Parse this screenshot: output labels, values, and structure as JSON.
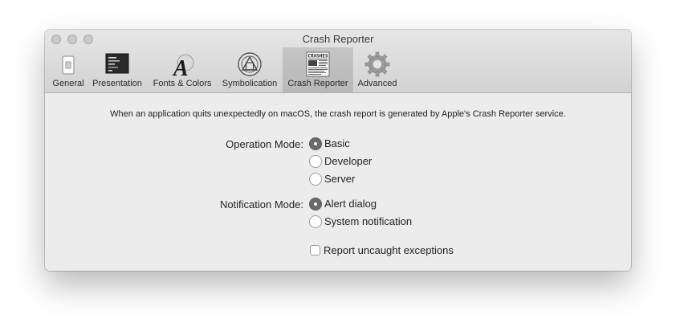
{
  "window": {
    "title": "Crash Reporter"
  },
  "tabs": [
    {
      "label": "General",
      "icon": "switch-icon",
      "selected": false
    },
    {
      "label": "Presentation",
      "icon": "terminal-window-icon",
      "selected": false
    },
    {
      "label": "Fonts & Colors",
      "icon": "font-letter-icon",
      "selected": false
    },
    {
      "label": "Symbolication",
      "icon": "symbolication-icon",
      "selected": false
    },
    {
      "label": "Crash Reporter",
      "icon": "crashes-document-icon",
      "selected": true
    },
    {
      "label": "Advanced",
      "icon": "gear-icon",
      "selected": false
    }
  ],
  "description": "When an application quits unexpectedly on macOS, the crash report is generated by Apple's Crash Reporter service.",
  "operation_mode": {
    "label": "Operation Mode:",
    "options": [
      "Basic",
      "Developer",
      "Server"
    ],
    "selected": "Basic"
  },
  "notification_mode": {
    "label": "Notification Mode:",
    "options": [
      "Alert dialog",
      "System notification"
    ],
    "selected": "Alert dialog"
  },
  "report_exceptions": {
    "label": "Report uncaught exceptions",
    "checked": false
  },
  "icon_text": {
    "crashes": "CRASHES"
  }
}
